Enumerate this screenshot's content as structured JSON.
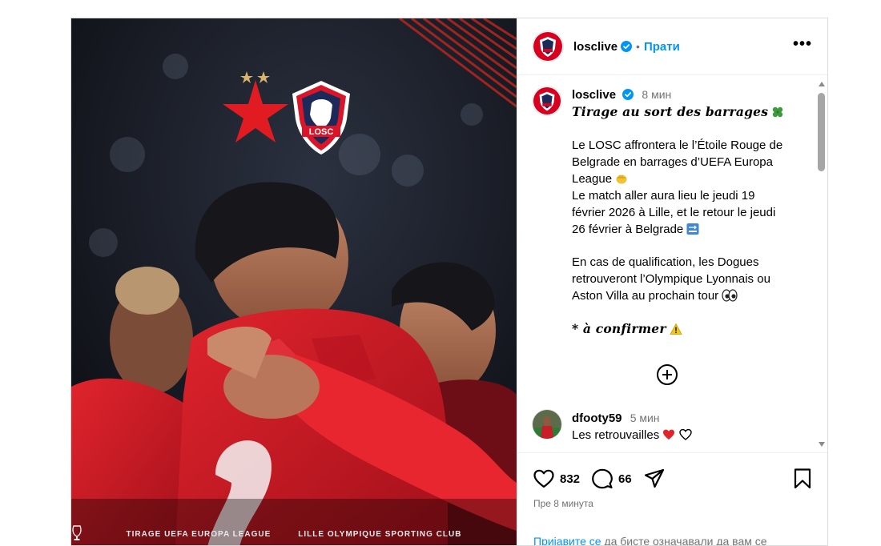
{
  "post": {
    "image": {
      "banner_left": "TIRAGE UEFA EUROPA LEAGUE",
      "banner_right": "LILLE OLYMPIQUE SPORTING CLUB",
      "logo_text": "LOSC"
    },
    "header": {
      "username": "losclive",
      "separator": "•",
      "follow_label": "Прати",
      "more_label": "•••"
    },
    "caption": {
      "username": "losclive",
      "time": "8 мин",
      "title": "Tirage au sort des barrages",
      "p1_lines": [
        "Le LOSC affrontera le l’Étoile Rouge de",
        "Belgrade en barrages d’UEFA Europa",
        "League"
      ],
      "p2_lines": [
        "Le match aller aura lieu le jeudi 19",
        "février 2026 à Lille, et le retour le jeudi",
        "26 février à Belgrade"
      ],
      "p3_lines": [
        "En cas de qualification, les Dogues",
        "retrouveront l’Olympique Lyonnais ou",
        "Aston Villa au prochain tour"
      ],
      "note": "* à confirmer"
    },
    "comments": [
      {
        "username": "dfooty59",
        "time": "5 мин",
        "text": "Les retrouvailles"
      }
    ],
    "actions": {
      "likes": "832",
      "comments": "66",
      "posted": "Пре 8 минута",
      "login_link": "Пријавите се",
      "login_text": " да бисте означавали да вам се"
    },
    "colors": {
      "brand_red": "#d8001f",
      "link_blue": "#0095f6",
      "verified_blue": "#0095f6",
      "losc_navy": "#1c2a5a"
    }
  }
}
